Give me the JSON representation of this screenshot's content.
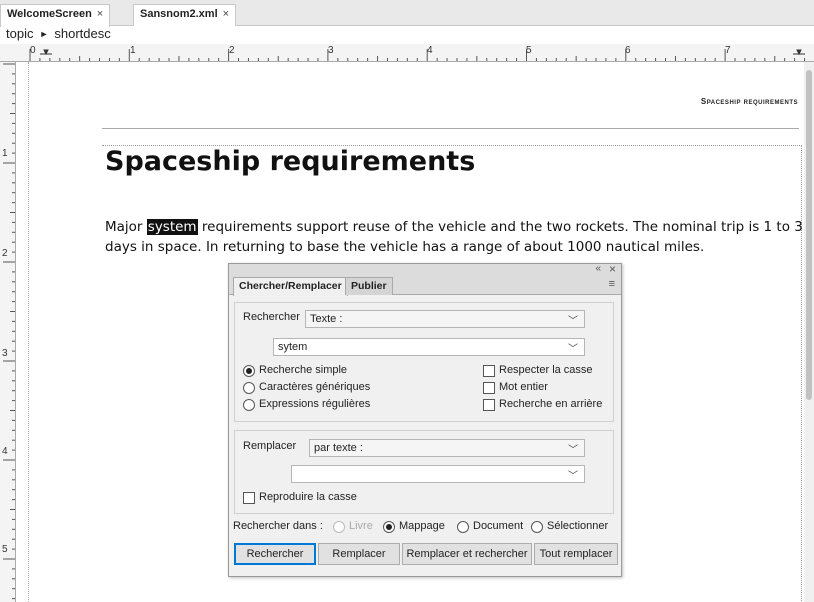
{
  "tabs": [
    {
      "label": "WelcomeScreen",
      "close": "×"
    },
    {
      "label": "Sansnom2.xml",
      "close": "×"
    }
  ],
  "breadcrumb": {
    "root": "topic",
    "separator": "►",
    "leaf": "shortdesc"
  },
  "ruler": {
    "h_labels": [
      "0",
      "1",
      "2",
      "3",
      "4",
      "5",
      "6",
      "7"
    ],
    "v_labels": [
      "1",
      "2",
      "3",
      "4",
      "5"
    ]
  },
  "document": {
    "running_head": "Spaceship requirements",
    "title": "Spaceship requirements",
    "para_before": "Major ",
    "para_highlight": "system",
    "para_after": " requirements support reuse of the vehicle and the two rockets. The nominal trip is 1 to 3 days in space. In returning to base the vehicle has a range of about 1000 nautical miles."
  },
  "dialog": {
    "controls": {
      "collapse": "«",
      "close": "×"
    },
    "tabs": [
      "Chercher/Remplacer",
      "Publier"
    ],
    "menu_icon": "≡",
    "search": {
      "label": "Rechercher",
      "type_value": "Texte :",
      "query_value": "sytem",
      "modes": [
        {
          "label": "Recherche simple",
          "checked": true
        },
        {
          "label": "Caractères génériques",
          "checked": false
        },
        {
          "label": "Expressions régulières",
          "checked": false
        }
      ],
      "options": [
        {
          "label": "Respecter la casse",
          "checked": false
        },
        {
          "label": "Mot entier",
          "checked": false
        },
        {
          "label": "Recherche en arrière",
          "checked": false
        }
      ]
    },
    "replace": {
      "label": "Remplacer",
      "type_value": "par texte :",
      "value": "",
      "preserve_case_label": "Reproduire la casse"
    },
    "scope": {
      "label": "Rechercher dans :",
      "options": [
        {
          "label": "Livre",
          "checked": false,
          "disabled": true
        },
        {
          "label": "Mappage",
          "checked": true,
          "disabled": false
        },
        {
          "label": "Document",
          "checked": false,
          "disabled": false
        },
        {
          "label": "Sélectionner",
          "checked": false,
          "disabled": false
        }
      ]
    },
    "buttons": [
      "Rechercher",
      "Remplacer",
      "Remplacer et rechercher",
      "Tout remplacer"
    ]
  },
  "colors": {
    "highlight_bg": "#111111",
    "highlight_text": "#ffffff",
    "default_button_border": "#0078d7"
  }
}
